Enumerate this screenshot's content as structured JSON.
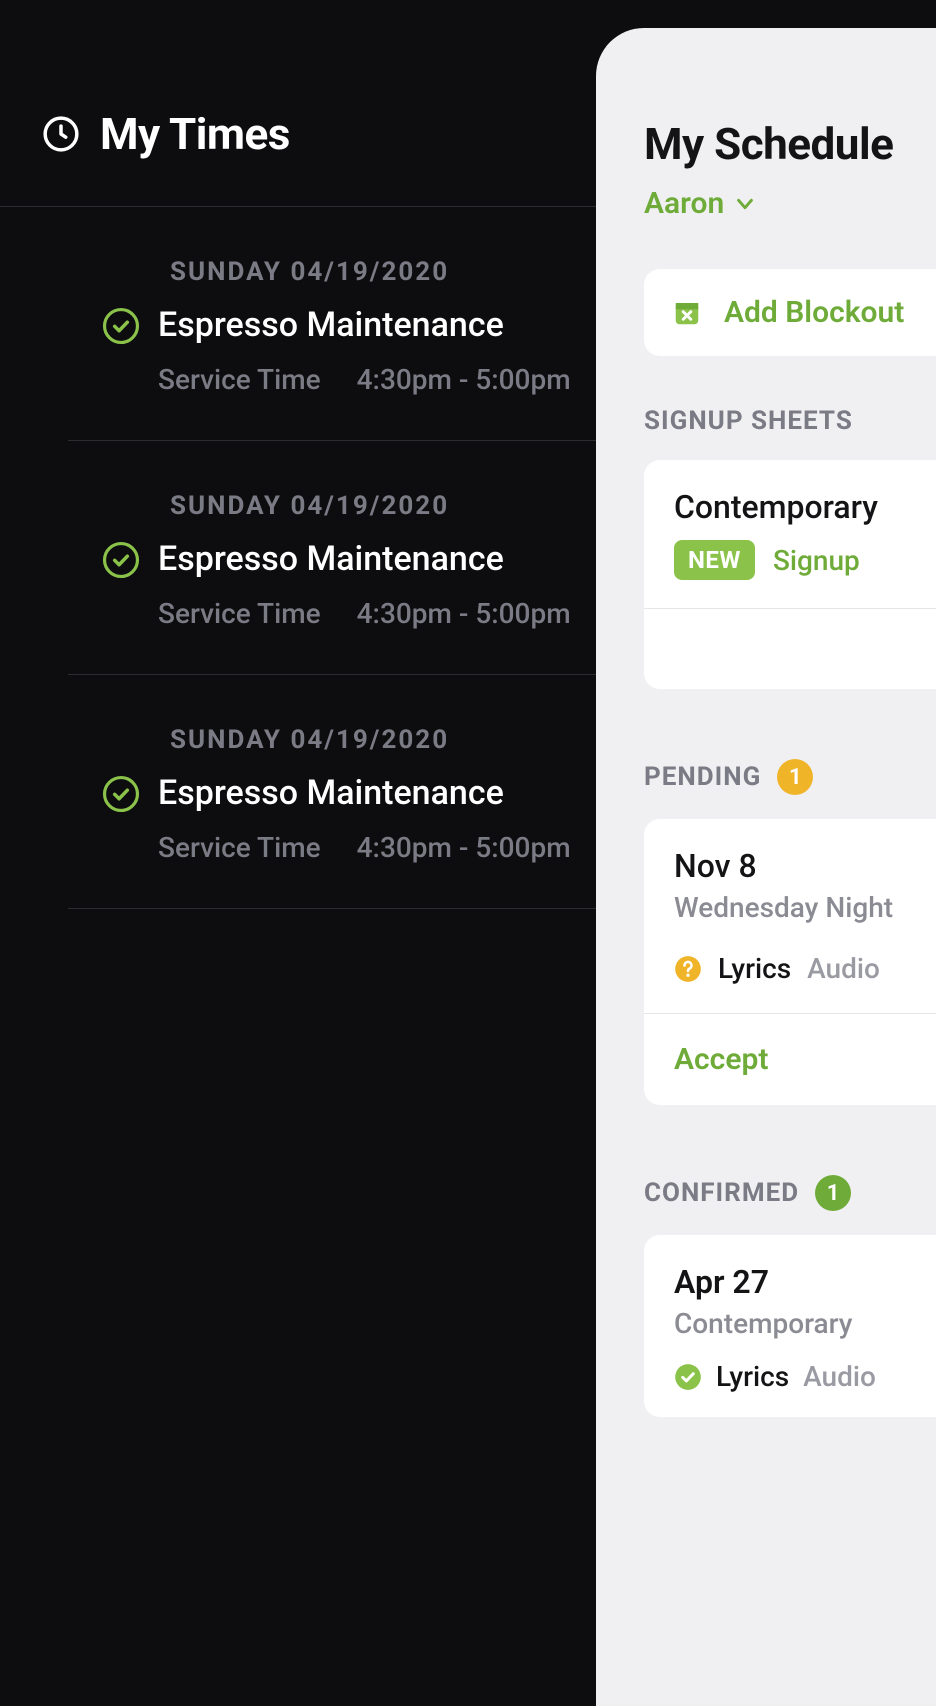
{
  "left": {
    "title": "My Times",
    "items": [
      {
        "date": "SUNDAY 04/19/2020",
        "title": "Espresso Maintenance",
        "service_label": "Service Time",
        "time": "4:30pm - 5:00pm"
      },
      {
        "date": "SUNDAY 04/19/2020",
        "title": "Espresso Maintenance",
        "service_label": "Service Time",
        "time": "4:30pm - 5:00pm"
      },
      {
        "date": "SUNDAY 04/19/2020",
        "title": "Espresso Maintenance",
        "service_label": "Service Time",
        "time": "4:30pm - 5:00pm"
      }
    ]
  },
  "right": {
    "title": "My Schedule",
    "user": "Aaron",
    "add_block": "Add Blockout",
    "signup": {
      "label": "SIGNUP SHEETS",
      "item": {
        "title": "Contemporary",
        "tag": "NEW",
        "action": "Signup"
      }
    },
    "pending": {
      "label": "PENDING",
      "count": "1",
      "item": {
        "date": "Nov 8",
        "subtitle": "Wednesday Night",
        "role_primary": "Lyrics",
        "role_secondary": "Audio",
        "accept": "Accept"
      }
    },
    "confirmed": {
      "label": "CONFIRMED",
      "count": "1",
      "item": {
        "date": "Apr 27",
        "subtitle": "Contemporary",
        "role_primary": "Lyrics",
        "role_secondary": "Audio"
      }
    }
  }
}
